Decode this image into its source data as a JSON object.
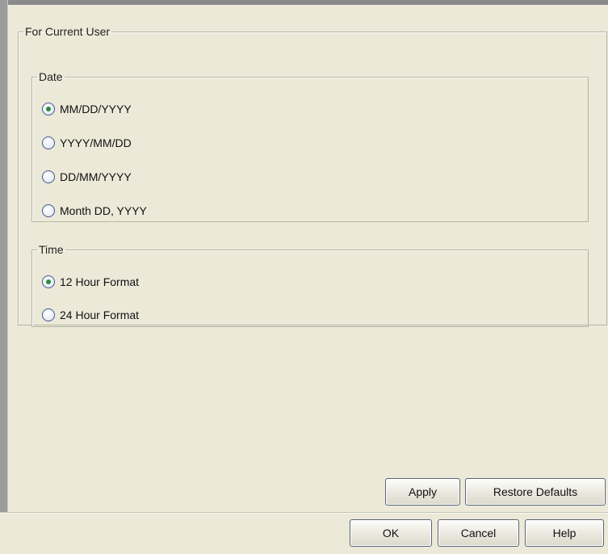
{
  "panel": {
    "title": "For Current User"
  },
  "date": {
    "legend": "Date",
    "options": [
      {
        "label": "MM/DD/YYYY",
        "checked": true
      },
      {
        "label": "YYYY/MM/DD",
        "checked": false
      },
      {
        "label": "DD/MM/YYYY",
        "checked": false
      },
      {
        "label": "Month DD, YYYY",
        "checked": false
      }
    ]
  },
  "time": {
    "legend": "Time",
    "options": [
      {
        "label": "12 Hour Format",
        "checked": true
      },
      {
        "label": "24 Hour Format",
        "checked": false
      }
    ]
  },
  "actions": {
    "apply": "Apply",
    "restore_defaults": "Restore Defaults"
  },
  "dialog_buttons": {
    "ok": "OK",
    "cancel": "Cancel",
    "help": "Help"
  }
}
